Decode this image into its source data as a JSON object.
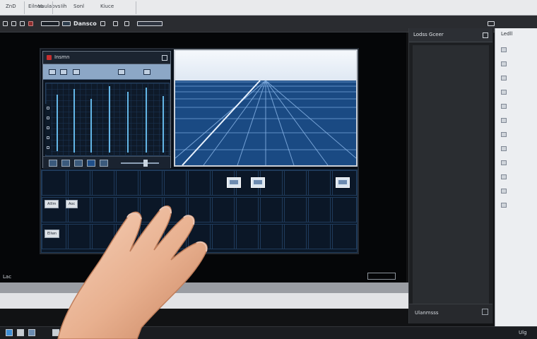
{
  "os_bar": {
    "items": [
      "ZnD",
      "Eilnes",
      "Vaulabvs",
      "Iih",
      "Sonl",
      "Kiuce"
    ]
  },
  "app": {
    "title": "Dansco"
  },
  "tool_window": {
    "title": "Insmn"
  },
  "lower_grid": {
    "chips": [
      "Alllm",
      "Aoc",
      "Ellwn"
    ]
  },
  "right_panel": {
    "title": "Lodss Gceer",
    "footer": "Ulanmsss"
  },
  "far_right_panel": {
    "title": "Ledll",
    "items": [
      "",
      "",
      "",
      "",
      "",
      "",
      "",
      "",
      "",
      "",
      "",
      ""
    ]
  },
  "status": {
    "left": "Lac"
  },
  "taskbar": {
    "right_text": "Ulg"
  },
  "colors": {
    "accent": "#3b6fb0",
    "grid_line": "#4f7ab3",
    "background": "#050608"
  },
  "icons": [
    "window-dot-icon",
    "toolbar-icon",
    "nav-icon",
    "thumbnail-icon",
    "taskbar-icon"
  ]
}
